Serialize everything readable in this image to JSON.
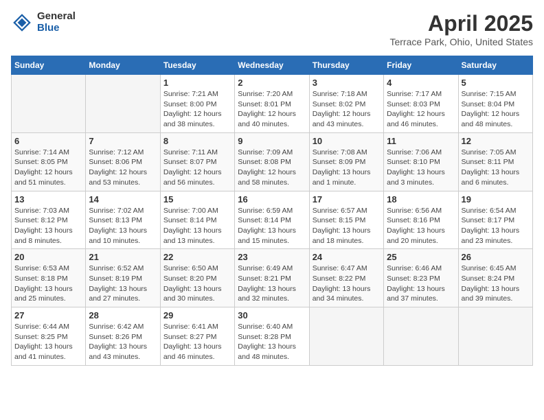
{
  "logo": {
    "general": "General",
    "blue": "Blue"
  },
  "title": "April 2025",
  "subtitle": "Terrace Park, Ohio, United States",
  "weekdays": [
    "Sunday",
    "Monday",
    "Tuesday",
    "Wednesday",
    "Thursday",
    "Friday",
    "Saturday"
  ],
  "weeks": [
    [
      {
        "day": "",
        "info": ""
      },
      {
        "day": "",
        "info": ""
      },
      {
        "day": "1",
        "info": "Sunrise: 7:21 AM\nSunset: 8:00 PM\nDaylight: 12 hours and 38 minutes."
      },
      {
        "day": "2",
        "info": "Sunrise: 7:20 AM\nSunset: 8:01 PM\nDaylight: 12 hours and 40 minutes."
      },
      {
        "day": "3",
        "info": "Sunrise: 7:18 AM\nSunset: 8:02 PM\nDaylight: 12 hours and 43 minutes."
      },
      {
        "day": "4",
        "info": "Sunrise: 7:17 AM\nSunset: 8:03 PM\nDaylight: 12 hours and 46 minutes."
      },
      {
        "day": "5",
        "info": "Sunrise: 7:15 AM\nSunset: 8:04 PM\nDaylight: 12 hours and 48 minutes."
      }
    ],
    [
      {
        "day": "6",
        "info": "Sunrise: 7:14 AM\nSunset: 8:05 PM\nDaylight: 12 hours and 51 minutes."
      },
      {
        "day": "7",
        "info": "Sunrise: 7:12 AM\nSunset: 8:06 PM\nDaylight: 12 hours and 53 minutes."
      },
      {
        "day": "8",
        "info": "Sunrise: 7:11 AM\nSunset: 8:07 PM\nDaylight: 12 hours and 56 minutes."
      },
      {
        "day": "9",
        "info": "Sunrise: 7:09 AM\nSunset: 8:08 PM\nDaylight: 12 hours and 58 minutes."
      },
      {
        "day": "10",
        "info": "Sunrise: 7:08 AM\nSunset: 8:09 PM\nDaylight: 13 hours and 1 minute."
      },
      {
        "day": "11",
        "info": "Sunrise: 7:06 AM\nSunset: 8:10 PM\nDaylight: 13 hours and 3 minutes."
      },
      {
        "day": "12",
        "info": "Sunrise: 7:05 AM\nSunset: 8:11 PM\nDaylight: 13 hours and 6 minutes."
      }
    ],
    [
      {
        "day": "13",
        "info": "Sunrise: 7:03 AM\nSunset: 8:12 PM\nDaylight: 13 hours and 8 minutes."
      },
      {
        "day": "14",
        "info": "Sunrise: 7:02 AM\nSunset: 8:13 PM\nDaylight: 13 hours and 10 minutes."
      },
      {
        "day": "15",
        "info": "Sunrise: 7:00 AM\nSunset: 8:14 PM\nDaylight: 13 hours and 13 minutes."
      },
      {
        "day": "16",
        "info": "Sunrise: 6:59 AM\nSunset: 8:14 PM\nDaylight: 13 hours and 15 minutes."
      },
      {
        "day": "17",
        "info": "Sunrise: 6:57 AM\nSunset: 8:15 PM\nDaylight: 13 hours and 18 minutes."
      },
      {
        "day": "18",
        "info": "Sunrise: 6:56 AM\nSunset: 8:16 PM\nDaylight: 13 hours and 20 minutes."
      },
      {
        "day": "19",
        "info": "Sunrise: 6:54 AM\nSunset: 8:17 PM\nDaylight: 13 hours and 23 minutes."
      }
    ],
    [
      {
        "day": "20",
        "info": "Sunrise: 6:53 AM\nSunset: 8:18 PM\nDaylight: 13 hours and 25 minutes."
      },
      {
        "day": "21",
        "info": "Sunrise: 6:52 AM\nSunset: 8:19 PM\nDaylight: 13 hours and 27 minutes."
      },
      {
        "day": "22",
        "info": "Sunrise: 6:50 AM\nSunset: 8:20 PM\nDaylight: 13 hours and 30 minutes."
      },
      {
        "day": "23",
        "info": "Sunrise: 6:49 AM\nSunset: 8:21 PM\nDaylight: 13 hours and 32 minutes."
      },
      {
        "day": "24",
        "info": "Sunrise: 6:47 AM\nSunset: 8:22 PM\nDaylight: 13 hours and 34 minutes."
      },
      {
        "day": "25",
        "info": "Sunrise: 6:46 AM\nSunset: 8:23 PM\nDaylight: 13 hours and 37 minutes."
      },
      {
        "day": "26",
        "info": "Sunrise: 6:45 AM\nSunset: 8:24 PM\nDaylight: 13 hours and 39 minutes."
      }
    ],
    [
      {
        "day": "27",
        "info": "Sunrise: 6:44 AM\nSunset: 8:25 PM\nDaylight: 13 hours and 41 minutes."
      },
      {
        "day": "28",
        "info": "Sunrise: 6:42 AM\nSunset: 8:26 PM\nDaylight: 13 hours and 43 minutes."
      },
      {
        "day": "29",
        "info": "Sunrise: 6:41 AM\nSunset: 8:27 PM\nDaylight: 13 hours and 46 minutes."
      },
      {
        "day": "30",
        "info": "Sunrise: 6:40 AM\nSunset: 8:28 PM\nDaylight: 13 hours and 48 minutes."
      },
      {
        "day": "",
        "info": ""
      },
      {
        "day": "",
        "info": ""
      },
      {
        "day": "",
        "info": ""
      }
    ]
  ]
}
